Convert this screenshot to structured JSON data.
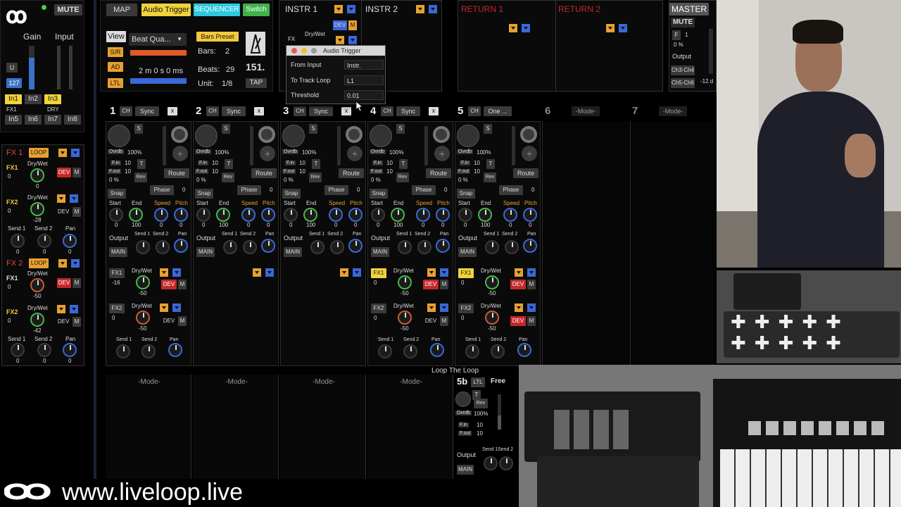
{
  "left": {
    "gain_label": "Gain",
    "input_label": "Input",
    "mute_label": "MUTE",
    "u_label": "U",
    "gain_value": "127",
    "inputs": [
      "In1",
      "In2",
      "In3",
      "In5",
      "In6",
      "In7",
      "In8"
    ],
    "fx1_tag": "FX1",
    "dry_tag": "DRY",
    "fx1": {
      "title": "FX 1",
      "loop": "LOOP",
      "rows": [
        {
          "tag": "FX1",
          "val": "0",
          "drywet": "Dry/Wet",
          "knob": "0",
          "dev": "DEV",
          "m": "M"
        },
        {
          "tag": "FX2",
          "val": "0",
          "drywet": "Dry/Wet",
          "knob": "-28",
          "dev": "DEV",
          "m": "M"
        }
      ],
      "send1": "Send 1",
      "send2": "Send 2",
      "pan": "Pan",
      "sv": [
        "0",
        "0",
        "0"
      ]
    },
    "fx2": {
      "title": "FX 2",
      "loop": "LOOP",
      "rows": [
        {
          "tag": "FX1",
          "val": "0",
          "drywet": "Dry/Wet",
          "knob": "-50",
          "dev": "DEV",
          "m": "M"
        },
        {
          "tag": "FX2",
          "val": "0",
          "drywet": "Dry/Wet",
          "knob": "-42",
          "dev": "DEV",
          "m": "M"
        }
      ],
      "send1": "Send 1",
      "send2": "Send 2",
      "pan": "Pan",
      "sv": [
        "0",
        "0",
        "0"
      ]
    }
  },
  "top": {
    "map": "MAP",
    "audio_trigger": "Audio Trigger",
    "sequencer": "SEQUENCER",
    "switch": "Switch",
    "view": "View",
    "preset": "Beat Qua...",
    "bars_preset": "Bars Preset",
    "bars_label": "Bars:",
    "bars_value": "2",
    "beats_label": "Beats:",
    "beats_value": "29",
    "unit_label": "Unit:",
    "unit_value": "1/8",
    "bpm": "151.",
    "tap": "TAP",
    "time": "2 m 0 s 0 ms",
    "sr": "S/R",
    "ad": "AD",
    "ltl": "LTL"
  },
  "instr": {
    "i1": "INSTR 1",
    "i2": "INSTR 2",
    "fx": "FX",
    "drywet": "Dry/Wet",
    "dev": "DEV",
    "m": "M"
  },
  "returns": {
    "r1": "RETURN 1",
    "r2": "RETURN 2"
  },
  "master": {
    "title": "MASTER",
    "mute": "MUTE",
    "f": "F",
    "f_val": "1",
    "pct": "0 %",
    "output": "Output",
    "ch34": "Ch3-Ch4",
    "ch56": "Ch5-Ch6",
    "db": "-12 d"
  },
  "popup": {
    "title": "Audio Trigger",
    "rows": [
      {
        "k": "From Input",
        "v": "Instr."
      },
      {
        "k": "To Track Loop",
        "v": "L1"
      },
      {
        "k": "Threshold",
        "v": "0.01"
      }
    ]
  },
  "tracks": [
    {
      "num": "1",
      "ch": "CH",
      "sync": "Sync",
      "x": "x"
    },
    {
      "num": "2",
      "ch": "CH",
      "sync": "Sync",
      "x": "x"
    },
    {
      "num": "3",
      "ch": "CH",
      "sync": "Sync",
      "x": "x"
    },
    {
      "num": "4",
      "ch": "CH",
      "sync": "Sync",
      "x": "x"
    },
    {
      "num": "5",
      "ch": "CH",
      "sync": "One ...",
      "x": ""
    }
  ],
  "track_labels": {
    "s": "S",
    "ovrdb": "Ovrdb",
    "ovrdb_val": "100%",
    "fin": "F.in",
    "fout": "F.out",
    "t": "T",
    "rev": "Rev",
    "ten": "10",
    "zero_pct": "0 %",
    "route": "Route",
    "phase": "Phase",
    "phase_val": "0",
    "snap": "Snap",
    "start": "Start",
    "end": "End",
    "speed": "Speed",
    "pitch": "Pitch",
    "start_val": "0",
    "end_val": "100",
    "sp_val": "0",
    "output": "Output",
    "main": "MAIN",
    "send1": "Send 1",
    "send2": "Send 2",
    "pan": "Pan",
    "fx1": "FX1",
    "fx2": "FX2",
    "drywet": "Dry/Wet",
    "dev": "DEV",
    "m": "M",
    "neg50": "-50",
    "zero": "0",
    "fx1_t1": "-16"
  },
  "modes": {
    "n6": "6",
    "n7": "7",
    "mode": "-Mode-"
  },
  "loop_the_loop": {
    "title": "Loop The Loop",
    "num": "5b",
    "ltl": "LTL",
    "free": "Free",
    "t": "T",
    "rev": "Rev",
    "ovrdb": "Ovrdb",
    "pct": "100%",
    "fin": "F.in",
    "fout": "F.out",
    "ten": "10",
    "send1": "Send 1",
    "send2": "Send 2",
    "output": "Output",
    "main": "MAIN"
  },
  "footer": {
    "url": "www.liveloop.live"
  },
  "colors": {
    "yellow": "#f1d33b",
    "cyan": "#2ec8df",
    "green": "#3fb24a",
    "red": "#c42828",
    "orange": "#e7a030",
    "blue": "#3a68d8",
    "master": "#555555"
  }
}
